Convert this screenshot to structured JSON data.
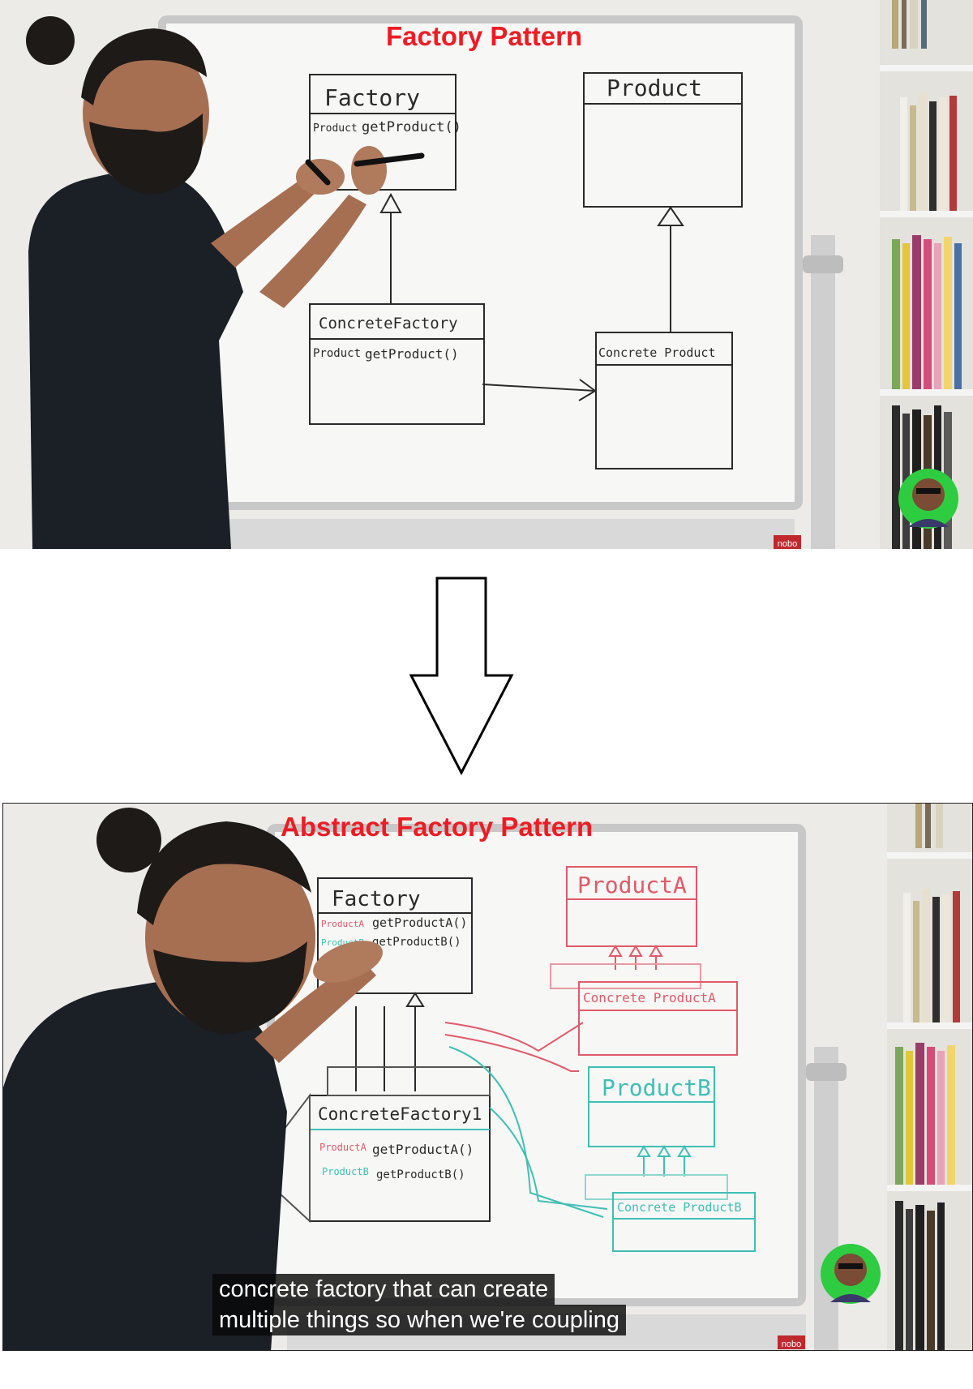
{
  "top": {
    "title": "Factory Pattern",
    "board": {
      "factory_title": "Factory",
      "factory_method_type": "Product",
      "factory_method": "getProduct()",
      "product_title": "Product",
      "concrete_factory_title": "ConcreteFactory",
      "concrete_factory_method_type": "Product",
      "concrete_factory_method": "getProduct()",
      "concrete_product_title": "Concrete Product",
      "stand_brand": "nobo"
    }
  },
  "bottom": {
    "title": "Abstract Factory Pattern",
    "board": {
      "factory_title": "Factory",
      "factory_method_a_type": "ProductA",
      "factory_method_a": "getProductA()",
      "factory_method_b_type": "ProductB",
      "factory_method_b": "getProductB()",
      "product_a_title": "ProductA",
      "concrete_product_a_title": "Concrete ProductA",
      "product_b_title": "ProductB",
      "concrete_product_b_title": "Concrete ProductB",
      "concrete_factory_title": "ConcreteFactory1",
      "cf_method_a_type": "ProductA",
      "cf_method_a": "getProductA()",
      "cf_method_b_type": "ProductB",
      "cf_method_b": "getProductB()",
      "stand_brand": "nobo"
    },
    "caption_line1": "concrete factory that can create",
    "caption_line2": "multiple things so when we're coupling"
  },
  "colors": {
    "title_red": "#ed1c24",
    "marker_black": "#2a2a2a",
    "marker_red": "#e05a6a",
    "marker_teal": "#3fbfb5",
    "avatar_green": "#2ecc40"
  }
}
